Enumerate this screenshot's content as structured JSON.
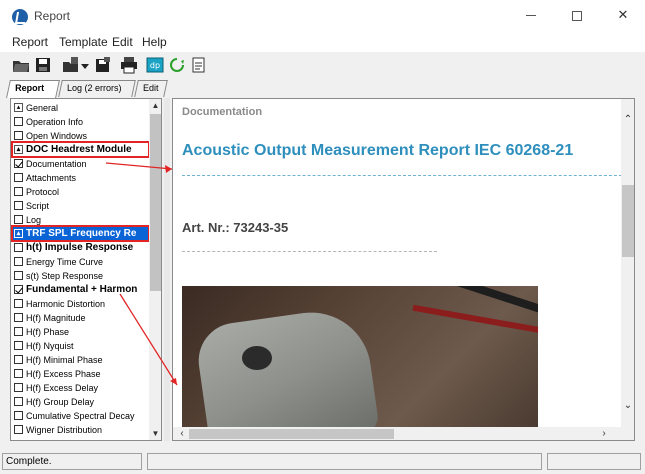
{
  "window": {
    "title": "Report"
  },
  "menu": {
    "items": [
      "Report",
      "Template",
      "Edit",
      "Help"
    ]
  },
  "toolbar": {
    "icons": [
      "open-folder-icon",
      "save-icon",
      "load-template-icon",
      "dropdown-icon",
      "save-template-icon",
      "print-icon",
      "dp-icon",
      "refresh-icon",
      "export-icon"
    ],
    "dp_label": "dp"
  },
  "tabs": [
    {
      "label": "Report",
      "active": true
    },
    {
      "label": "Log (2 errors)",
      "active": false
    },
    {
      "label": "Edit",
      "active": false
    }
  ],
  "tree": {
    "items": [
      {
        "label": "General",
        "kind": "expander",
        "bold": false,
        "checked": false
      },
      {
        "label": "Operation Info",
        "kind": "checkbox",
        "bold": false,
        "checked": false
      },
      {
        "label": "Open Windows",
        "kind": "checkbox",
        "bold": false,
        "checked": false
      },
      {
        "label": "DOC Headrest Module",
        "kind": "expander",
        "bold": true,
        "checked": false
      },
      {
        "label": "Documentation",
        "kind": "checkbox",
        "bold": false,
        "checked": true
      },
      {
        "label": "Attachments",
        "kind": "checkbox",
        "bold": false,
        "checked": false
      },
      {
        "label": "Protocol",
        "kind": "checkbox",
        "bold": false,
        "checked": false
      },
      {
        "label": "Script",
        "kind": "checkbox",
        "bold": false,
        "checked": false
      },
      {
        "label": "Log",
        "kind": "checkbox",
        "bold": false,
        "checked": false
      },
      {
        "label": "TRF SPL Frequency Re",
        "kind": "expander",
        "bold": true,
        "checked": false,
        "selected": true
      },
      {
        "label": "h(t) Impulse Response",
        "kind": "checkbox",
        "bold": true,
        "checked": false
      },
      {
        "label": "Energy Time Curve",
        "kind": "checkbox",
        "bold": false,
        "checked": false
      },
      {
        "label": "s(t) Step Response",
        "kind": "checkbox",
        "bold": false,
        "checked": false
      },
      {
        "label": "Fundamental + Harmon",
        "kind": "checkbox",
        "bold": true,
        "checked": true
      },
      {
        "label": "Harmonic Distortion",
        "kind": "checkbox",
        "bold": false,
        "checked": false
      },
      {
        "label": "H(f) Magnitude",
        "kind": "checkbox",
        "bold": false,
        "checked": false
      },
      {
        "label": "H(f) Phase",
        "kind": "checkbox",
        "bold": false,
        "checked": false
      },
      {
        "label": "H(f) Nyquist",
        "kind": "checkbox",
        "bold": false,
        "checked": false
      },
      {
        "label": "H(f) Minimal Phase",
        "kind": "checkbox",
        "bold": false,
        "checked": false
      },
      {
        "label": "H(f) Excess Phase",
        "kind": "checkbox",
        "bold": false,
        "checked": false
      },
      {
        "label": "H(f) Excess Delay",
        "kind": "checkbox",
        "bold": false,
        "checked": false
      },
      {
        "label": "H(f) Group Delay",
        "kind": "checkbox",
        "bold": false,
        "checked": false
      },
      {
        "label": "Cumulative Spectral Decay",
        "kind": "checkbox",
        "bold": false,
        "checked": false
      },
      {
        "label": "Wigner Distribution",
        "kind": "checkbox",
        "bold": false,
        "checked": false
      }
    ]
  },
  "document": {
    "section": "Documentation",
    "title": "Acoustic Output Measurement Report IEC 60268-21",
    "art_nr": "Art. Nr.: 73243-35"
  },
  "status": {
    "text": "Complete."
  },
  "colors": {
    "selection": "#0a64d6",
    "title_blue": "#2e8fbd",
    "annotation_red": "#e22424"
  }
}
